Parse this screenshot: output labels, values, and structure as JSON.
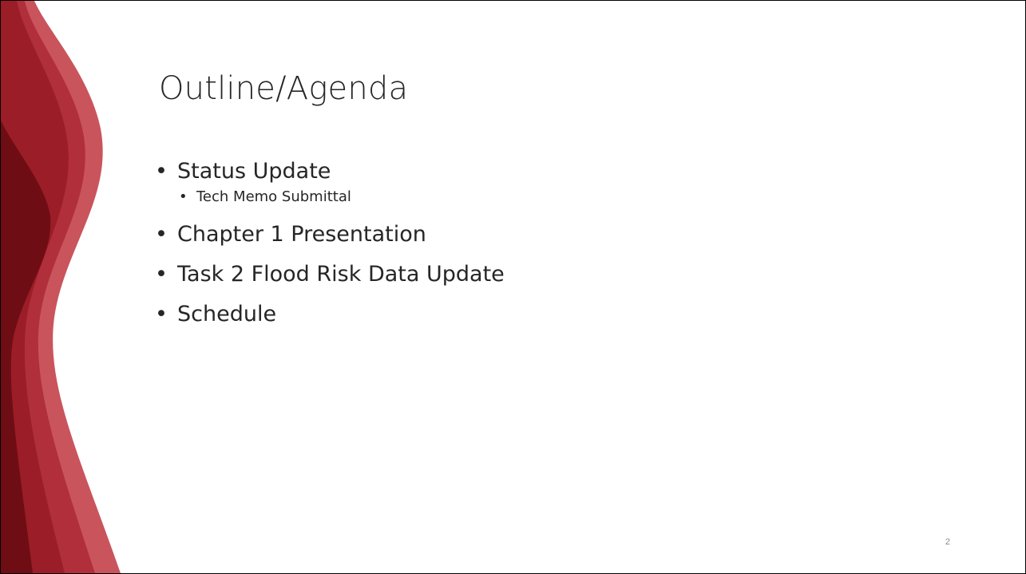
{
  "slide": {
    "title": "Outline/Agenda",
    "bullets": [
      {
        "text": "Status Update",
        "level": 1
      },
      {
        "text": "Tech Memo Submittal",
        "level": 2
      },
      {
        "text": "Chapter 1 Presentation",
        "level": 1
      },
      {
        "text": "Task 2 Flood Risk Data Update",
        "level": 1
      },
      {
        "text": "Schedule",
        "level": 1
      }
    ],
    "page_number": "2"
  },
  "colors": {
    "accent_dark": "#7a1119",
    "accent_mid": "#a3202b",
    "accent_light": "#c2404a",
    "text": "#262626"
  },
  "icons": [
    "wave-decoration"
  ]
}
